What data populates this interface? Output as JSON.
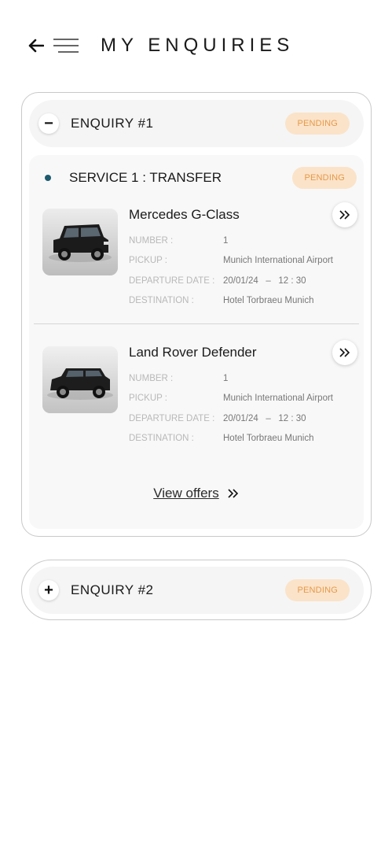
{
  "header": {
    "title": "MY ENQUIRIES",
    "back_icon": "arrow-left-icon",
    "menu_icon": "hamburger-menu-icon"
  },
  "enquiries": [
    {
      "title": "ENQUIRY #1",
      "status": "PENDING",
      "toggle": "−",
      "expanded": true,
      "services": [
        {
          "title": "SERVICE 1 : TRANSFER",
          "status": "PENDING",
          "vehicles": [
            {
              "name": "Mercedes G-Class",
              "number_label": "NUMBER :",
              "number": "1",
              "pickup_label": "PICKUP :",
              "pickup": "Munich International Airport",
              "departure_label": "DEPARTURE DATE :",
              "departure_date": "20/01/24",
              "departure_sep": "–",
              "departure_time": "12 : 30",
              "destination_label": "DESTINATION :",
              "destination": "Hotel Torbraeu Munich"
            },
            {
              "name": "Land Rover Defender",
              "number_label": "NUMBER :",
              "number": "1",
              "pickup_label": "PICKUP :",
              "pickup": "Munich International Airport",
              "departure_label": "DEPARTURE DATE :",
              "departure_date": "20/01/24",
              "departure_sep": "–",
              "departure_time": "12 : 30",
              "destination_label": "DESTINATION :",
              "destination": "Hotel Torbraeu Munich"
            }
          ],
          "view_offers": "View offers"
        }
      ]
    },
    {
      "title": "ENQUIRY #2",
      "status": "PENDING",
      "toggle": "+",
      "expanded": false
    }
  ],
  "colors": {
    "badge_bg": "#fbe3c9",
    "badge_text": "#e59a4a",
    "service_dot": "#1e5a6e"
  }
}
